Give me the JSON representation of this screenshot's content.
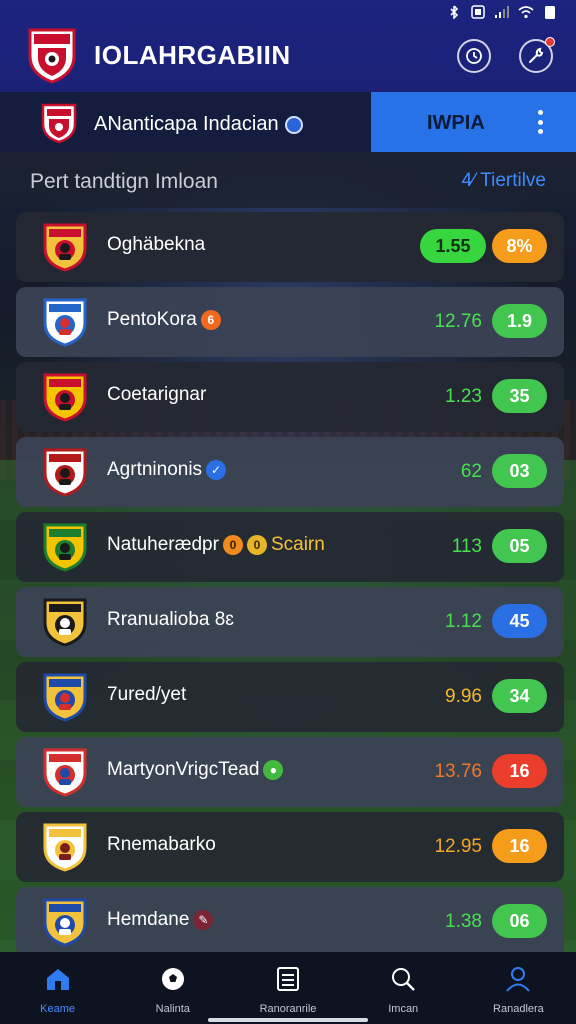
{
  "header": {
    "title": "IOLAHRGABIIN",
    "timer_icon": "timer-icon",
    "tools_icon": "wrench-icon"
  },
  "league": {
    "name": "ANanticapa Indacian",
    "tab_label": "IWPIA"
  },
  "section": {
    "title": "Pert tandtign Imloan",
    "link": "4⁄ Tiertilve"
  },
  "teams": [
    {
      "name": "Oghäbekna",
      "badge": "",
      "odds": "",
      "pill1": "1.55",
      "pill2": "8%",
      "pill_color": "orange",
      "crest_colors": [
        "#c8102e",
        "#f3c23c",
        "#1a1a1a"
      ]
    },
    {
      "name": "PentoKora",
      "badge": "6",
      "odds": "12.76",
      "pill2": "1.9",
      "pill_color": "green",
      "crest_colors": [
        "#2565c8",
        "#ffffff",
        "#d32f2f"
      ]
    },
    {
      "name": "Coetarignar",
      "badge": "",
      "odds": "1.23",
      "pill2": "35",
      "pill_color": "green",
      "crest_colors": [
        "#c8102e",
        "#f5c400",
        "#1a1a1a"
      ]
    },
    {
      "name": "Agrtninonis",
      "badge": "",
      "odds": "62",
      "pill2": "03",
      "pill_color": "green",
      "crest_colors": [
        "#b31b1b",
        "#ffffff",
        "#1a1a1a"
      ]
    },
    {
      "name": "Natuherædpr",
      "badge": "Scairn",
      "odds": "113",
      "pill2": "05",
      "pill_color": "green",
      "crest_colors": [
        "#1e7d2e",
        "#f5c400",
        "#1a1a1a"
      ]
    },
    {
      "name": "Rranualioba 8ɛ",
      "badge": "",
      "odds": "1.12",
      "pill2": "45",
      "pill_color": "blue",
      "crest_colors": [
        "#1a1a1a",
        "#f3c23c",
        "#ffffff"
      ]
    },
    {
      "name": "7ured/yet",
      "badge": "",
      "odds": "9.96",
      "pill2": "34",
      "pill_color": "green",
      "crest_colors": [
        "#1f4aa8",
        "#f3c23c",
        "#d32f2f"
      ]
    },
    {
      "name": "MartyonVrigcTead",
      "badge": "",
      "odds": "13.76",
      "pill2": "16",
      "pill_color": "red",
      "crest_colors": [
        "#d32f2f",
        "#ffffff",
        "#1f4aa8"
      ]
    },
    {
      "name": "Rnemabarko",
      "badge": "",
      "odds": "12.95",
      "pill2": "16",
      "pill_color": "orange",
      "crest_colors": [
        "#f3c23c",
        "#ffffff",
        "#7a1d1d"
      ]
    },
    {
      "name": "Hemdane",
      "badge": "",
      "odds": "1.38",
      "pill2": "06",
      "pill_color": "green",
      "crest_colors": [
        "#1f4aa8",
        "#f3c23c",
        "#ffffff"
      ]
    }
  ],
  "odds_colors": [
    "#ffffff",
    "#49e04f",
    "#49e04f",
    "#49e04f",
    "#49e04f",
    "#49e04f",
    "#f5b92a",
    "#f2752a",
    "#f5a623",
    "#49e04f"
  ],
  "nav": [
    {
      "label": "Keame",
      "icon": "home-icon",
      "active": true
    },
    {
      "label": "Nalinta",
      "icon": "ball-icon",
      "active": false
    },
    {
      "label": "Ranoranrile",
      "icon": "list-icon",
      "active": false
    },
    {
      "label": "Imcan",
      "icon": "search-icon",
      "active": false
    },
    {
      "label": "Ranadlera",
      "icon": "user-icon",
      "active": false
    }
  ],
  "colors": {
    "header_bg": "#1c2380",
    "accent_blue": "#2672e6",
    "card_bg": "#242832"
  }
}
